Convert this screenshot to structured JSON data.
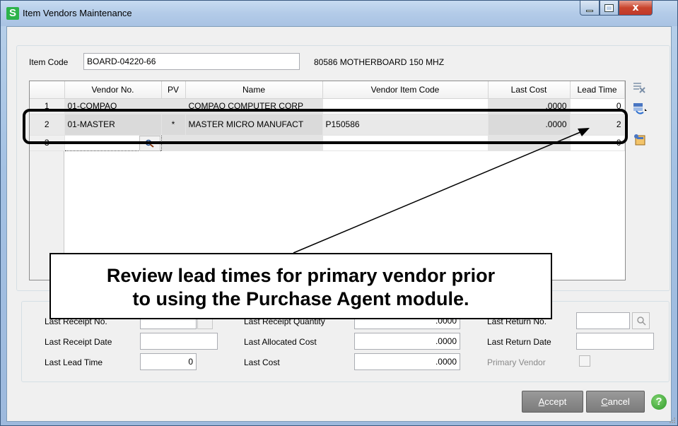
{
  "window": {
    "app_icon_letter": "S",
    "title": "Item Vendors Maintenance",
    "close_glyph": "x"
  },
  "item": {
    "code_label": "Item Code",
    "code_value": "BOARD-04220-66",
    "description": "80586 MOTHERBOARD 150 MHZ"
  },
  "grid": {
    "columns": [
      "Vendor No.",
      "PV",
      "Name",
      "Vendor Item Code",
      "Last Cost",
      "Lead Time"
    ],
    "rows": [
      {
        "num": "1",
        "vendor_no": "01-COMPAQ",
        "pv": "",
        "name": "COMPAQ COMPUTER CORP",
        "vendor_item_code": "",
        "last_cost": ".0000",
        "lead_time": "0"
      },
      {
        "num": "2",
        "vendor_no": "01-MASTER",
        "pv": "*",
        "name": "MASTER MICRO MANUFACT",
        "vendor_item_code": "P150586",
        "last_cost": ".0000",
        "lead_time": "2"
      },
      {
        "num": "3",
        "vendor_no": "",
        "pv": "",
        "name": "",
        "vendor_item_code": "",
        "last_cost": "",
        "lead_time": "0"
      }
    ]
  },
  "details": {
    "last_receipt_no_label": "Last Receipt No.",
    "last_receipt_qty_label": "Last Receipt Quantity",
    "last_receipt_qty_value": ".0000",
    "last_return_no_label": "Last Return No.",
    "last_receipt_date_label": "Last Receipt Date",
    "last_receipt_date_value": "",
    "last_allocated_cost_label": "Last Allocated Cost",
    "last_allocated_cost_value": ".0000",
    "last_return_date_label": "Last Return Date",
    "last_return_date_value": "",
    "last_lead_time_label": "Last Lead Time",
    "last_lead_time_value": "0",
    "last_cost_label": "Last Cost",
    "last_cost_value": ".0000",
    "primary_vendor_label": "Primary Vendor"
  },
  "callout": {
    "line1": "Review lead times for primary vendor prior",
    "line2": "to using the Purchase Agent module."
  },
  "buttons": {
    "accept_underlined": "A",
    "accept_rest": "ccept",
    "cancel_underlined": "C",
    "cancel_rest": "ancel",
    "help_glyph": "?"
  },
  "icons": {
    "side_icon_1": "delete-row-icon",
    "side_icon_2": "default-vendor-icon",
    "side_icon_3": "copy-vendor-icon"
  }
}
